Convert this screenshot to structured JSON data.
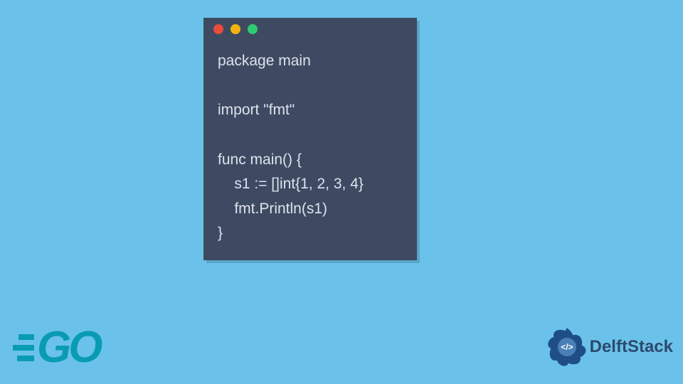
{
  "code": {
    "lines": [
      "package main",
      "",
      "import \"fmt\"",
      "",
      "func main() {",
      "    s1 := []int{1, 2, 3, 4}",
      "    fmt.Println(s1)",
      "}"
    ]
  },
  "window": {
    "dot_colors": [
      "#e74c3c",
      "#f1b40f",
      "#2ecc71"
    ]
  },
  "logos": {
    "go_label": "GO",
    "brand_label": "DelftStack"
  },
  "colors": {
    "background": "#6ac2ea",
    "window_bg": "#3e4a62",
    "code_text": "#dde3ec",
    "go_color": "#0a9bb4",
    "brand_color": "#2d4a6e"
  }
}
